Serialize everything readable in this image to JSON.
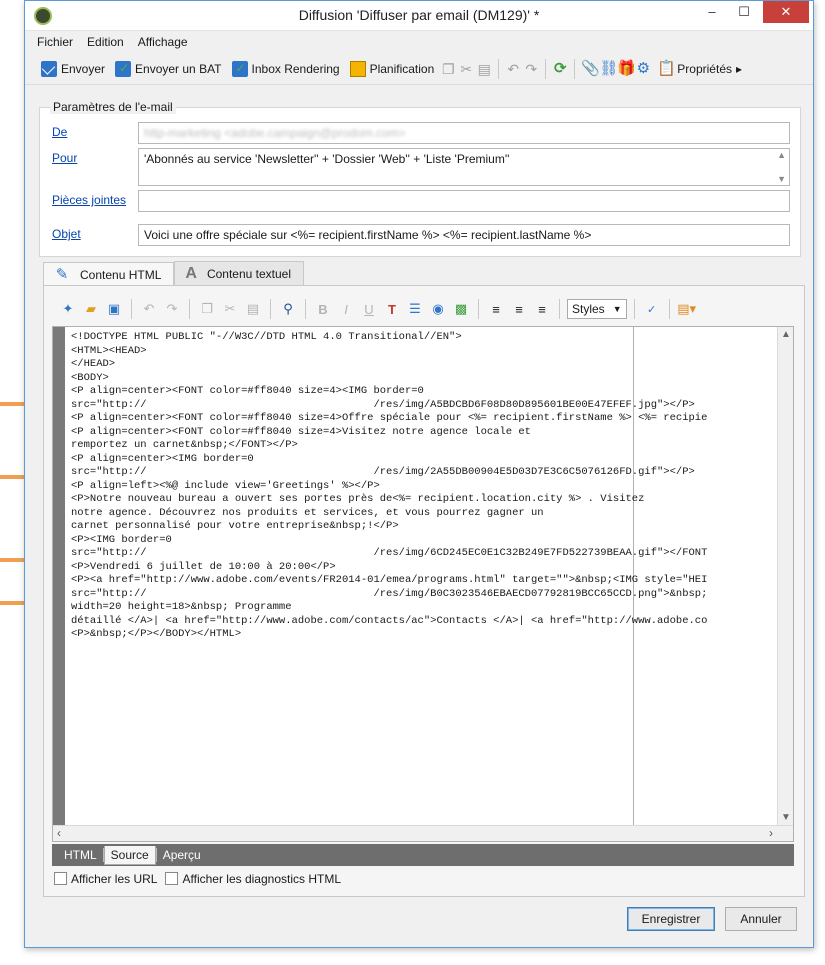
{
  "window": {
    "title": "Diffusion 'Diffuser par email (DM129)' *",
    "minimize": "–",
    "maximize": "☐",
    "close": "✕"
  },
  "menu": [
    "Fichier",
    "Edition",
    "Affichage"
  ],
  "toolbar": {
    "send": "Envoyer",
    "send_bat": "Envoyer un BAT",
    "inbox_rendering": "Inbox Rendering",
    "planification": "Planification",
    "properties": "Propriétés"
  },
  "email_params": {
    "legend": "Paramètres de l'e-mail",
    "from_label": "De",
    "from_value": "http-marketing <adobe.campaign@prodom.com>",
    "to_label": "Pour",
    "to_value": "'Abonnés au service 'Newsletter'' + 'Dossier 'Web'' + 'Liste 'Premium''",
    "attachments_label": "Pièces jointes",
    "attachments_value": "",
    "subject_label": "Objet",
    "subject_value": "Voici une offre spéciale sur <%= recipient.firstName %> <%= recipient.lastName %>"
  },
  "tabs": {
    "html": "Contenu HTML",
    "text": "Contenu textuel"
  },
  "editor": {
    "styles_label": "Styles",
    "code_lines": [
      "<!DOCTYPE HTML PUBLIC \"-//W3C//DTD HTML 4.0 Transitional//EN\">",
      "<HTML><HEAD>",
      "</HEAD>",
      "<BODY>",
      "<P align=center><FONT color=#ff8040 size=4><IMG border=0",
      "src=\"http://                                    /res/img/A5BDCBD6F08D80D895601BE00E47EFEF.jpg\"></P>",
      "<P align=center><FONT color=#ff8040 size=4>Offre spéciale pour <%= recipient.firstName %> <%= recipie",
      "<P align=center><FONT color=#ff8040 size=4>Visitez notre agence locale et",
      "remportez un carnet&nbsp;</FONT></P>",
      "<P align=center><IMG border=0",
      "src=\"http://                                    /res/img/2A55DB00904E5D03D7E3C6C5076126FD.gif\"></P>",
      "<P align=left><%@ include view='Greetings' %></P>",
      "<P>Notre nouveau bureau a ouvert ses portes près de<%= recipient.location.city %> . Visitez",
      "notre agence. Découvrez nos produits et services, et vous pourrez gagner un",
      "carnet personnalisé pour votre entreprise&nbsp;!</P>",
      "<P><IMG border=0",
      "src=\"http://                                    /res/img/6CD245EC0E1C32B249E7FD522739BEAA.gif\"></FONT",
      "<P>Vendredi 6 juillet de 10:00 à 20:00</P>",
      "<P><a href=\"http://www.adobe.com/events/FR2014-01/emea/programs.html\" target=\"\">&nbsp;<IMG style=\"HEI",
      "src=\"http://                                    /res/img/B0C3023546EBAECD07792819BCC65CCD.png\">&nbsp;",
      "width=20 height=18>&nbsp; Programme",
      "détaillé </A>| <a href=\"http://www.adobe.com/contacts/ac\">Contacts </A>| <a href=\"http://www.adobe.co",
      "<P>&nbsp;</P></BODY></HTML>"
    ]
  },
  "bottom_tabs": [
    "HTML",
    "Source",
    "Aperçu"
  ],
  "checkboxes": {
    "show_urls": "Afficher les URL",
    "show_diagnostics": "Afficher les diagnostics HTML"
  },
  "footer": {
    "save": "Enregistrer",
    "cancel": "Annuler"
  },
  "colors": {
    "accent": "#5a9bd5",
    "arrow": "#f0a050",
    "close": "#c7403a"
  }
}
